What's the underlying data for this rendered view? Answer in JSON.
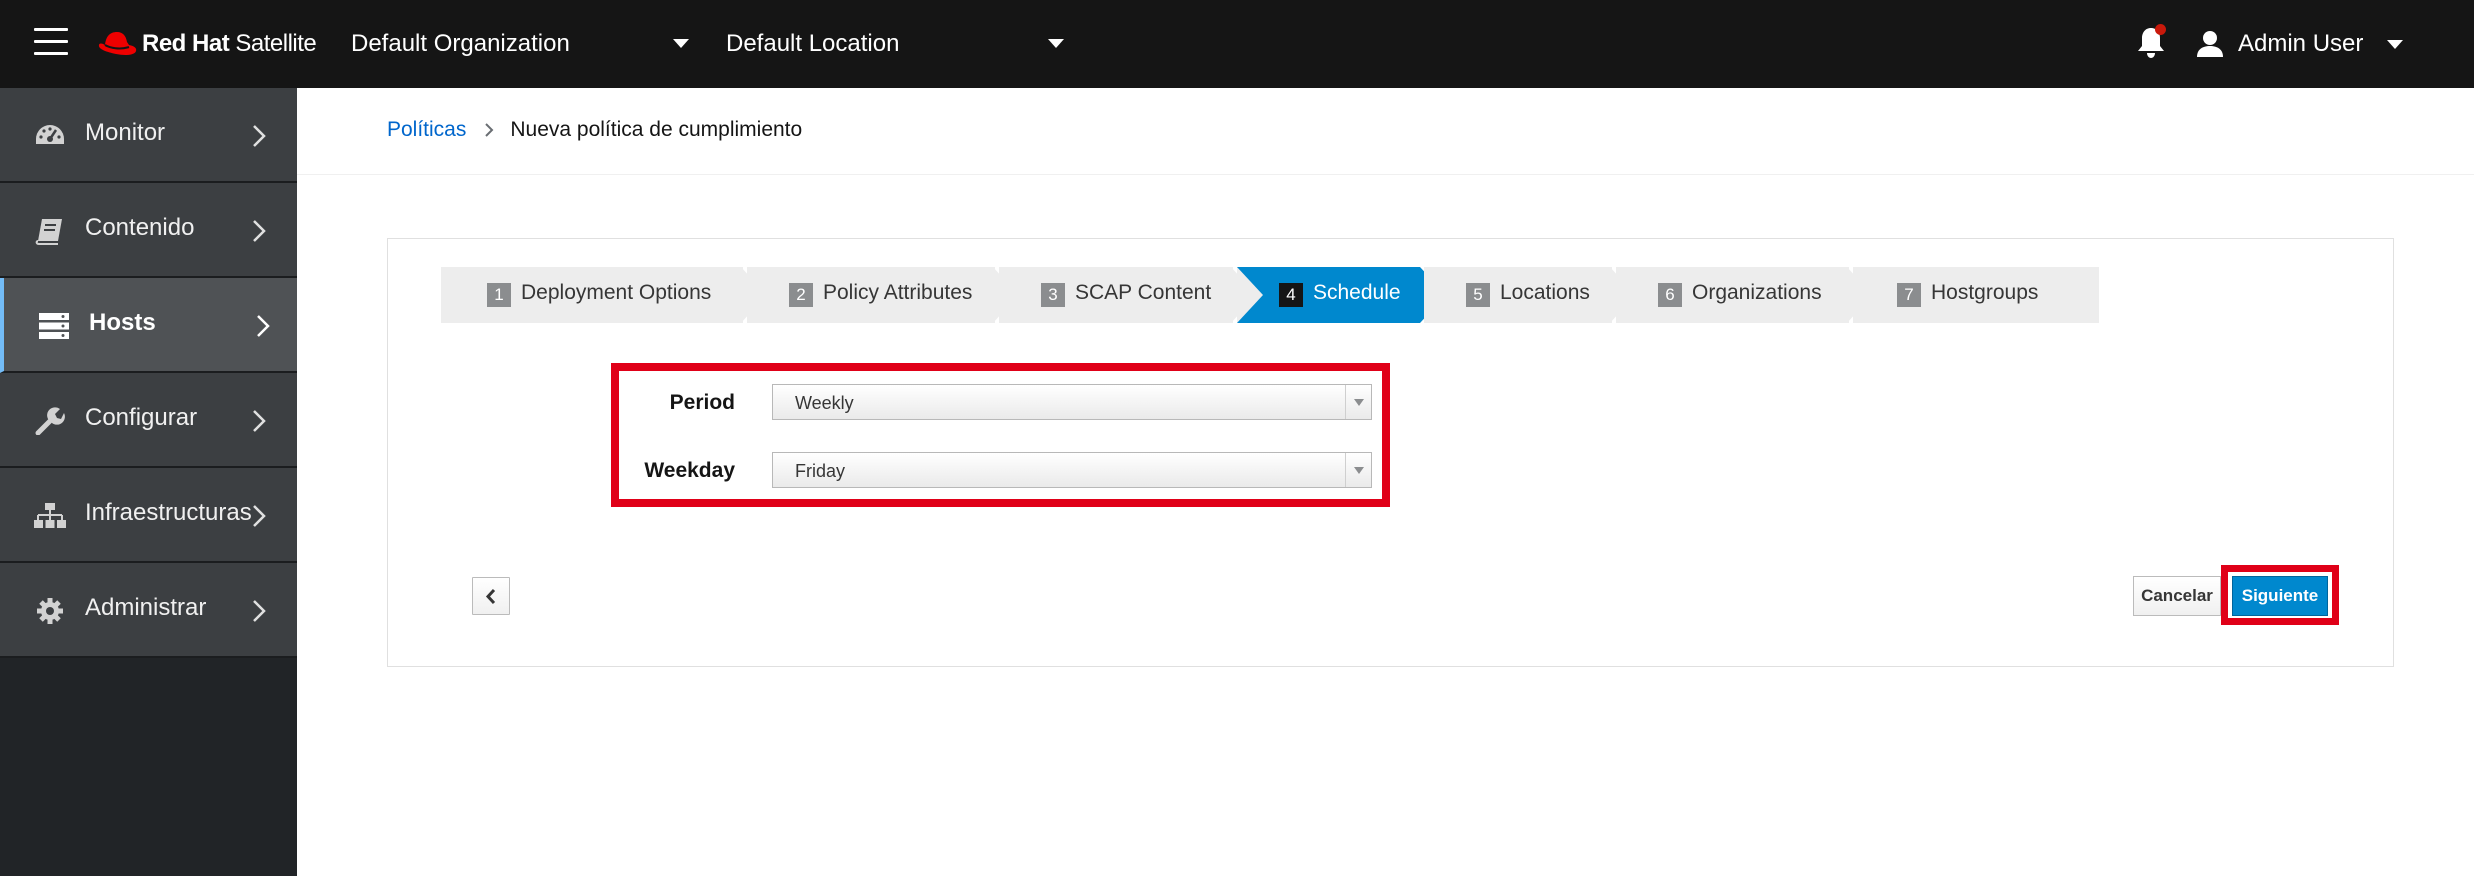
{
  "masthead": {
    "brand_bold": "Red Hat",
    "brand_rest": "Satellite",
    "organization": "Default Organization",
    "location": "Default Location",
    "user": "Admin User",
    "notification_dot_color": "#c9190b"
  },
  "sidebar": {
    "items": [
      {
        "label": "Monitor",
        "icon": "dashboard-icon"
      },
      {
        "label": "Contenido",
        "icon": "book-icon"
      },
      {
        "label": "Hosts",
        "icon": "server-icon",
        "active": true
      },
      {
        "label": "Configurar",
        "icon": "wrench-icon"
      },
      {
        "label": "Infraestructuras",
        "icon": "sitemap-icon"
      },
      {
        "label": "Administrar",
        "icon": "cog-icon"
      }
    ]
  },
  "breadcrumb": {
    "parent": "Políticas",
    "current": "Nueva política de cumplimiento"
  },
  "wizard": {
    "steps": [
      {
        "num": "1",
        "label": "Deployment Options"
      },
      {
        "num": "2",
        "label": "Policy Attributes"
      },
      {
        "num": "3",
        "label": "SCAP Content"
      },
      {
        "num": "4",
        "label": "Schedule",
        "current": true
      },
      {
        "num": "5",
        "label": "Locations"
      },
      {
        "num": "6",
        "label": "Organizations"
      },
      {
        "num": "7",
        "label": "Hostgroups"
      }
    ],
    "accent_color": "#0088ce"
  },
  "form": {
    "period_label": "Period",
    "period_value": "Weekly",
    "weekday_label": "Weekday",
    "weekday_value": "Friday"
  },
  "actions": {
    "cancel": "Cancelar",
    "next": "Siguiente"
  },
  "highlight_color": "#e00018"
}
